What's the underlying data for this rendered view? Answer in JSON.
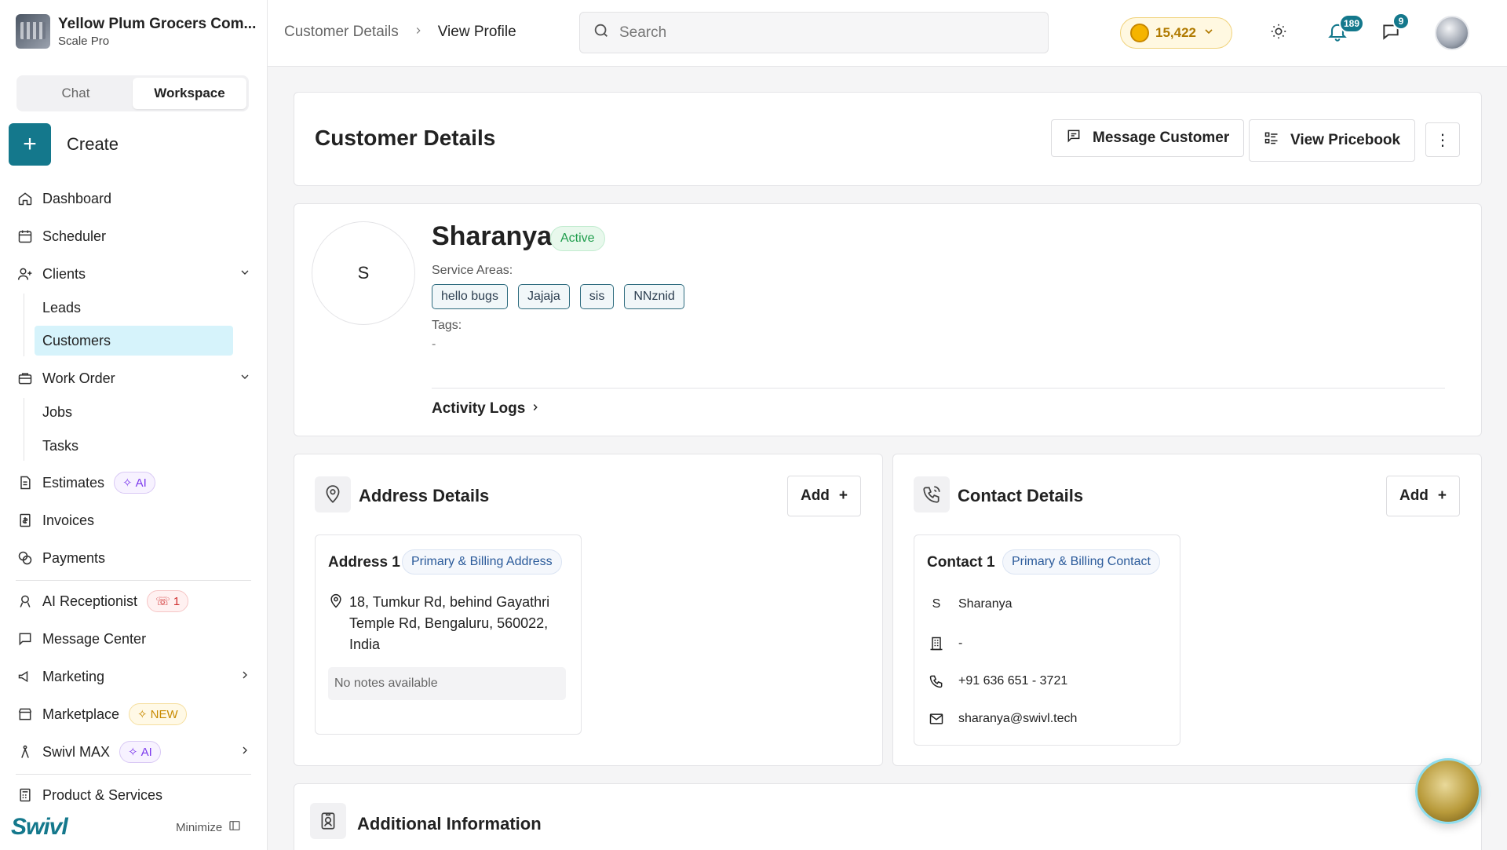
{
  "org": {
    "name": "Yellow Plum Grocers Com...",
    "plan": "Scale Pro"
  },
  "mode": {
    "chat": "Chat",
    "workspace": "Workspace"
  },
  "create_label": "Create",
  "nav": {
    "dashboard": "Dashboard",
    "scheduler": "Scheduler",
    "clients": "Clients",
    "leads": "Leads",
    "customers": "Customers",
    "work_order": "Work Order",
    "jobs": "Jobs",
    "tasks": "Tasks",
    "estimates": "Estimates",
    "estimates_badge": "AI",
    "invoices": "Invoices",
    "payments": "Payments",
    "ai_receptionist": "AI Receptionist",
    "ai_receptionist_badge": "1",
    "message_center": "Message Center",
    "marketing": "Marketing",
    "marketplace": "Marketplace",
    "marketplace_badge": "NEW",
    "swivl_max": "Swivl MAX",
    "swivl_max_badge": "AI",
    "products": "Product & Services"
  },
  "brand": "Swivl",
  "minimize": "Minimize",
  "breadcrumb": {
    "parent": "Customer Details",
    "current": "View Profile"
  },
  "search": {
    "placeholder": "Search"
  },
  "coins": "15,422",
  "notifications_count": "189",
  "messages_count": "9",
  "header": {
    "title": "Customer Details",
    "message_btn": "Message Customer",
    "pricebook_btn": "View Pricebook"
  },
  "customer": {
    "initial": "S",
    "name": "Sharanya",
    "status": "Active",
    "service_areas_label": "Service Areas:",
    "service_areas": [
      "hello bugs",
      "Jajaja",
      "sis",
      "NNznid"
    ],
    "tags_label": "Tags:",
    "tags_value": "-",
    "activity_logs": "Activity Logs"
  },
  "address": {
    "title": "Address Details",
    "add": "Add",
    "card_title": "Address 1",
    "card_pill": "Primary & Billing Address",
    "address_text": "18, Tumkur Rd, behind Gayathri Temple Rd, Bengaluru, 560022, India",
    "notes": "No notes available"
  },
  "contact": {
    "title": "Contact Details",
    "add": "Add",
    "card_title": "Contact 1",
    "card_pill": "Primary & Billing Contact",
    "initial": "S",
    "name": "Sharanya",
    "company": "-",
    "phone": "+91 636 651 - 3721",
    "email": "sharanya@swivl.tech"
  },
  "additional": {
    "title": "Additional Information"
  },
  "colors": {
    "accent": "#14788c",
    "active_bg": "#d6f3fb",
    "status_green": "#1f9d4c"
  }
}
